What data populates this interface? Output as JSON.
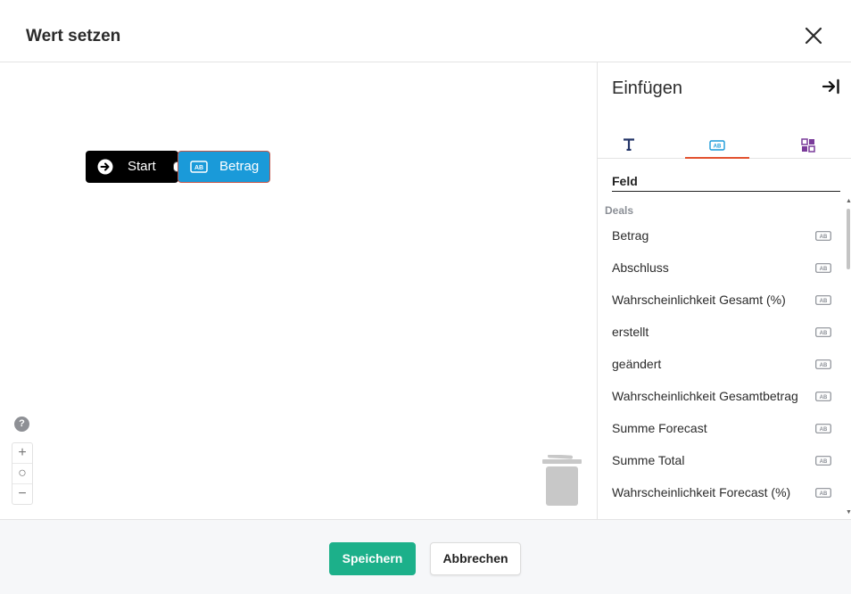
{
  "dialog": {
    "title": "Wert setzen"
  },
  "canvas": {
    "start_block": {
      "label": "Start",
      "icon": "arrow-circle-right-icon"
    },
    "field_block": {
      "label": "Betrag",
      "icon": "text-field-icon",
      "color": "#1a9ad9"
    },
    "help_label": "?",
    "zoom": {
      "in": "+",
      "reset": "○",
      "out": "−"
    }
  },
  "sidebar": {
    "title": "Einfügen",
    "tabs": [
      {
        "name": "text",
        "icon": "text-t-icon"
      },
      {
        "name": "field",
        "icon": "text-field-icon",
        "active": true
      },
      {
        "name": "functions",
        "icon": "functions-grid-icon"
      }
    ],
    "search_label": "Feld",
    "group_label": "Deals",
    "items": [
      {
        "label": "Betrag"
      },
      {
        "label": "Abschluss"
      },
      {
        "label": "Wahrscheinlichkeit Gesamt (%)"
      },
      {
        "label": "erstellt"
      },
      {
        "label": "geändert"
      },
      {
        "label": "Wahrscheinlichkeit Gesamtbetrag"
      },
      {
        "label": "Summe Forecast"
      },
      {
        "label": "Summe Total"
      },
      {
        "label": "Wahrscheinlichkeit Forecast (%)"
      }
    ]
  },
  "footer": {
    "save": "Speichern",
    "cancel": "Abbrechen"
  },
  "colors": {
    "primary": "#1cb08a",
    "accent": "#e2512e",
    "block_field": "#1a9ad9"
  }
}
